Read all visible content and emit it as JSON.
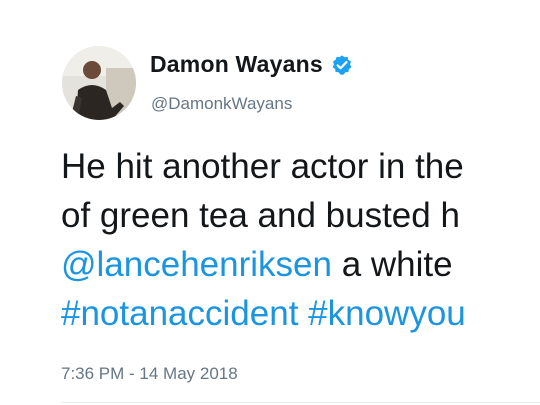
{
  "author": {
    "display_name": "Damon Wayans",
    "handle": "@DamonkWayans",
    "verified": true,
    "avatar": "profile-photo"
  },
  "tweet": {
    "line1": {
      "text": "He hit another actor in the"
    },
    "line2": {
      "text": "of green tea and busted h"
    },
    "line3": {
      "mention": "@lancehenriksen",
      "text": " a white"
    },
    "line4": {
      "hashtag1": "#notanaccident",
      "space": " ",
      "hashtag2": "#knowyou"
    }
  },
  "timestamp": "7:36 PM - 14 May 2018",
  "colors": {
    "link": "#1b95e0",
    "text": "#14171a",
    "secondary": "#657786",
    "verified_badge": "#1da1f2"
  }
}
